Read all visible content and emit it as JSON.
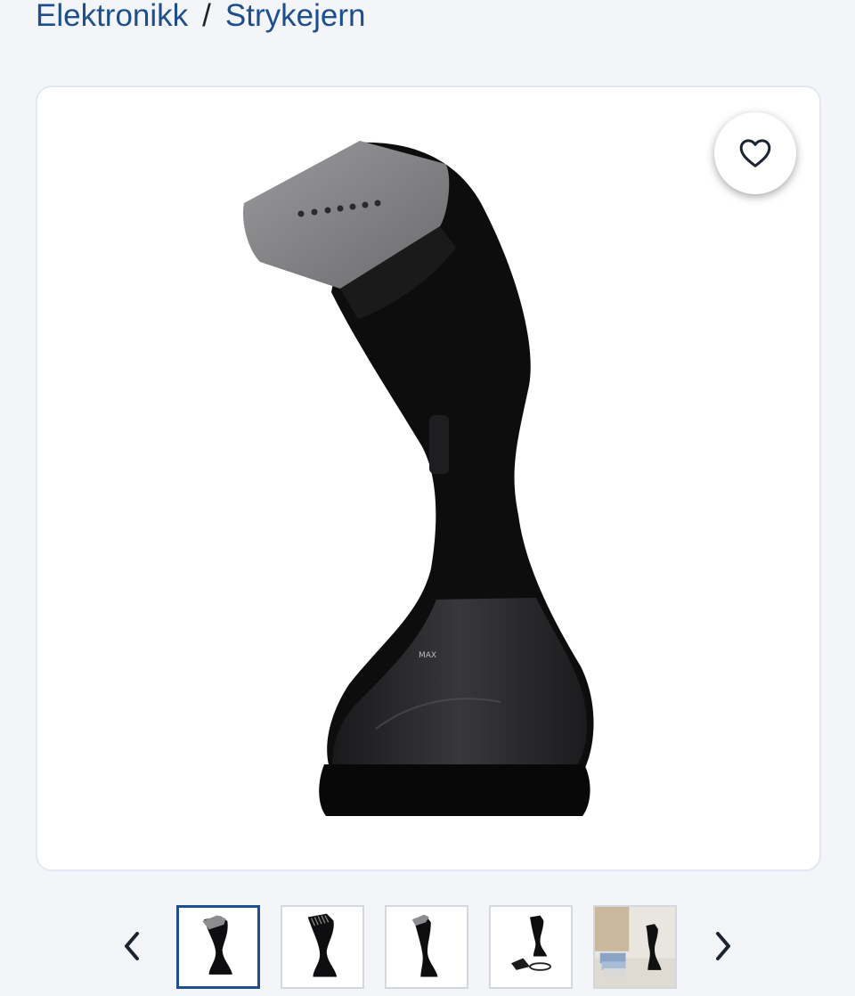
{
  "breadcrumb": {
    "items": [
      "Elektronikk",
      "Strykejern"
    ],
    "separator": "/"
  },
  "product": {
    "main_image_icon": "garment-steamer-image",
    "main_image_text": {
      "max_mark": "MAX"
    },
    "favorite_icon": "heart-outline-icon"
  },
  "gallery": {
    "prev_icon": "chevron-left-icon",
    "next_icon": "chevron-right-icon",
    "thumbnails": [
      {
        "icon": "steamer-front-thumbnail",
        "active": true
      },
      {
        "icon": "steamer-nozzle-thumbnail",
        "active": false
      },
      {
        "icon": "steamer-side-thumbnail",
        "active": false
      },
      {
        "icon": "steamer-accessories-thumbnail",
        "active": false
      },
      {
        "icon": "steamer-lifestyle-thumbnail",
        "active": false
      }
    ]
  },
  "colors": {
    "brand_blue": "#1d4f8c",
    "page_bg": "#f3f5f9",
    "card_border": "#e3e8f0"
  }
}
